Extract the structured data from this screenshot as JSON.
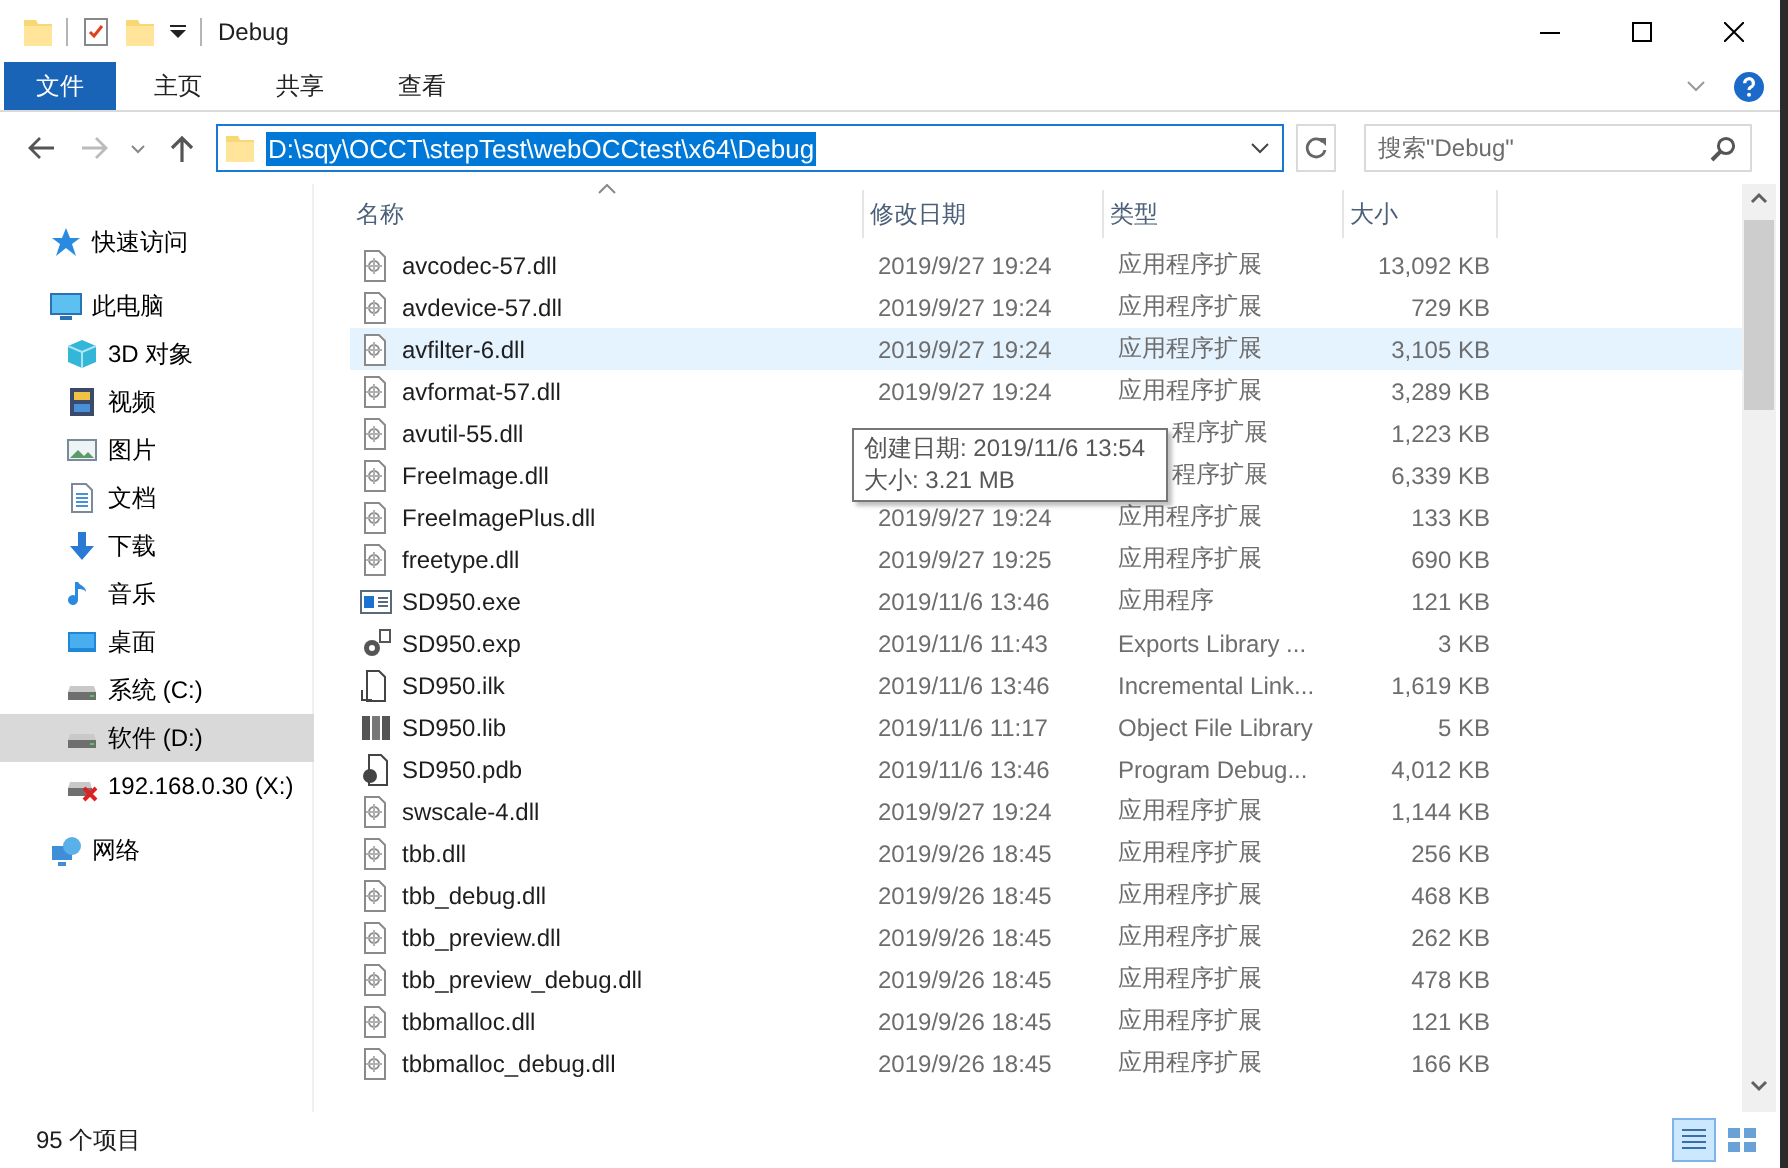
{
  "window": {
    "title": "Debug"
  },
  "ribbon": {
    "tabs": [
      {
        "label": "文件",
        "selected": true
      },
      {
        "label": "主页",
        "selected": false
      },
      {
        "label": "共享",
        "selected": false
      },
      {
        "label": "查看",
        "selected": false
      }
    ]
  },
  "address_bar": {
    "path": "D:\\sqy\\OCCT\\stepTest\\webOCCtest\\x64\\Debug",
    "text_selected": true
  },
  "search": {
    "placeholder": "搜索\"Debug\""
  },
  "navigation": {
    "items": [
      {
        "kind": "star",
        "label": "快速访问",
        "selected": false
      },
      {
        "kind": "pc",
        "label": "此电脑",
        "selected": false,
        "children": [
          {
            "kind": "cube",
            "label": "3D 对象",
            "selected": false
          },
          {
            "kind": "video",
            "label": "视频",
            "selected": false
          },
          {
            "kind": "pictures",
            "label": "图片",
            "selected": false
          },
          {
            "kind": "docs",
            "label": "文档",
            "selected": false
          },
          {
            "kind": "download",
            "label": "下载",
            "selected": false
          },
          {
            "kind": "music",
            "label": "音乐",
            "selected": false
          },
          {
            "kind": "desktop",
            "label": "桌面",
            "selected": false
          },
          {
            "kind": "drive",
            "label": "系统 (C:)",
            "selected": false
          },
          {
            "kind": "drive",
            "label": "软件 (D:)",
            "selected": true
          },
          {
            "kind": "netdrive",
            "label": "192.168.0.30 (X:)",
            "selected": false
          }
        ]
      },
      {
        "kind": "network",
        "label": "网络",
        "selected": false
      }
    ]
  },
  "file_list": {
    "columns": [
      {
        "label": "名称",
        "sorted": true
      },
      {
        "label": "修改日期",
        "sorted": false
      },
      {
        "label": "类型",
        "sorted": false
      },
      {
        "label": "大小",
        "sorted": false
      }
    ],
    "rows": [
      {
        "kind": "dll",
        "name": "avcodec-57.dll",
        "modified": "2019/9/27 19:24",
        "type": "应用程序扩展",
        "size": "13,092 KB",
        "hovered": false
      },
      {
        "kind": "dll",
        "name": "avdevice-57.dll",
        "modified": "2019/9/27 19:24",
        "type": "应用程序扩展",
        "size": "729 KB",
        "hovered": false
      },
      {
        "kind": "dll",
        "name": "avfilter-6.dll",
        "modified": "2019/9/27 19:24",
        "type": "应用程序扩展",
        "size": "3,105 KB",
        "hovered": true
      },
      {
        "kind": "dll",
        "name": "avformat-57.dll",
        "modified": "2019/9/27 19:24",
        "type": "应用程序扩展",
        "size": "3,289 KB",
        "hovered": false
      },
      {
        "kind": "dll",
        "name": "avutil-55.dll",
        "type": "程序扩展",
        "size": "1,223 KB",
        "hovered": false
      },
      {
        "kind": "dll",
        "name": "FreeImage.dll",
        "type": "程序扩展",
        "size": "6,339 KB",
        "hovered": false
      },
      {
        "kind": "dll",
        "name": "FreeImagePlus.dll",
        "modified": "2019/9/27 19:24",
        "type": "应用程序扩展",
        "size": "133 KB",
        "hovered": false
      },
      {
        "kind": "dll",
        "name": "freetype.dll",
        "modified": "2019/9/27 19:25",
        "type": "应用程序扩展",
        "size": "690 KB",
        "hovered": false
      },
      {
        "kind": "exe",
        "name": "SD950.exe",
        "modified": "2019/11/6 13:46",
        "type": "应用程序",
        "size": "121 KB",
        "hovered": false
      },
      {
        "kind": "exp",
        "name": "SD950.exp",
        "modified": "2019/11/6 11:43",
        "type": "Exports Library ...",
        "size": "3 KB",
        "hovered": false
      },
      {
        "kind": "ilk",
        "name": "SD950.ilk",
        "modified": "2019/11/6 13:46",
        "type": "Incremental Link...",
        "size": "1,619 KB",
        "hovered": false
      },
      {
        "kind": "lib",
        "name": "SD950.lib",
        "modified": "2019/11/6 11:17",
        "type": "Object File Library",
        "size": "5 KB",
        "hovered": false
      },
      {
        "kind": "pdb",
        "name": "SD950.pdb",
        "modified": "2019/11/6 13:46",
        "type": "Program Debug...",
        "size": "4,012 KB",
        "hovered": false
      },
      {
        "kind": "dll",
        "name": "swscale-4.dll",
        "modified": "2019/9/27 19:24",
        "type": "应用程序扩展",
        "size": "1,144 KB",
        "hovered": false
      },
      {
        "kind": "dll",
        "name": "tbb.dll",
        "modified": "2019/9/26 18:45",
        "type": "应用程序扩展",
        "size": "256 KB",
        "hovered": false
      },
      {
        "kind": "dll",
        "name": "tbb_debug.dll",
        "modified": "2019/9/26 18:45",
        "type": "应用程序扩展",
        "size": "468 KB",
        "hovered": false
      },
      {
        "kind": "dll",
        "name": "tbb_preview.dll",
        "modified": "2019/9/26 18:45",
        "type": "应用程序扩展",
        "size": "262 KB",
        "hovered": false
      },
      {
        "kind": "dll",
        "name": "tbb_preview_debug.dll",
        "modified": "2019/9/26 18:45",
        "type": "应用程序扩展",
        "size": "478 KB",
        "hovered": false
      },
      {
        "kind": "dll",
        "name": "tbbmalloc.dll",
        "modified": "2019/9/26 18:45",
        "type": "应用程序扩展",
        "size": "121 KB",
        "hovered": false
      },
      {
        "kind": "dll",
        "name": "tbbmalloc_debug.dll",
        "modified": "2019/9/26 18:45",
        "type": "应用程序扩展",
        "size": "166 KB",
        "hovered": false
      }
    ]
  },
  "tooltip": {
    "lines": [
      "创建日期: 2019/11/6 13:54",
      "大小: 3.21 MB"
    ]
  },
  "status_bar": {
    "item_count": "95 个项目"
  },
  "view_buttons": [
    {
      "kind": "details",
      "selected": true
    },
    {
      "kind": "tiles",
      "selected": false
    }
  ]
}
